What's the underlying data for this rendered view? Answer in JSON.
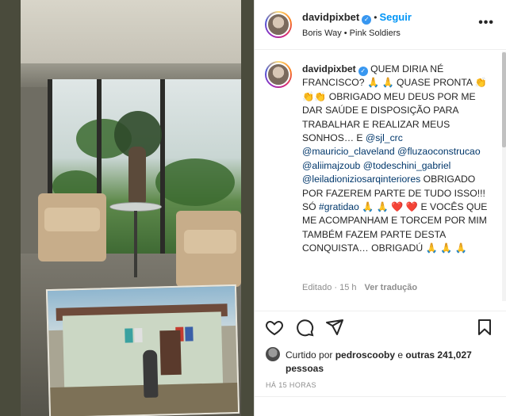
{
  "post": {
    "username": "davidpixbet",
    "follow_label": "Seguir",
    "subtitle": "Boris Way • Pink Soldiers",
    "more_label": "•••"
  },
  "caption": {
    "username": "davidpixbet",
    "line1": "QUEM DIRIA NÉ FRANCISCO? 🙏 🙏 QUASE PRONTA 👏👏👏 OBRIGADO MEU DEUS POR ME DAR SAÚDE E DISPOSIÇÃO PARA TRABALHAR E REALIZAR MEUS SONHOS… E ",
    "mentions": [
      "@sjl_crc",
      "@mauricio_claveland",
      "@fluzaoconstrucao",
      "@aliimajzoub",
      "@todeschini_gabriel",
      "@leiladionizio​sarqinteriores"
    ],
    "line2": " OBRIGADO POR FAZEREM PARTE DE TUDO ISSO!!! SÓ ",
    "hashtag": "#gratidao",
    "line3": " 🙏 🙏 ❤️ ❤️ E VOCÊS QUE ME ACOMPANHAM E TORCEM POR MIM TAMBÉM FAZEM PARTE DESTA CONQUISTA… OBRIGADÚ 🙏 🙏 🙏"
  },
  "meta": {
    "edited": "Editado · 15 h",
    "translate": "Ver tradução"
  },
  "likes": {
    "prefix": "Curtido por ",
    "user": "pedroscooby",
    "middle": " e ",
    "others": "outras 241,027 pessoas"
  },
  "timestamp": "HÁ 15 HORAS",
  "icons": [
    "heart-icon",
    "comment-icon",
    "share-icon",
    "bookmark-icon",
    "more-icon",
    "verified-icon"
  ],
  "colors": {
    "accent": "#0095f6",
    "verified": "#3897f0",
    "link": "#00376b",
    "muted": "#8e8e8e"
  }
}
